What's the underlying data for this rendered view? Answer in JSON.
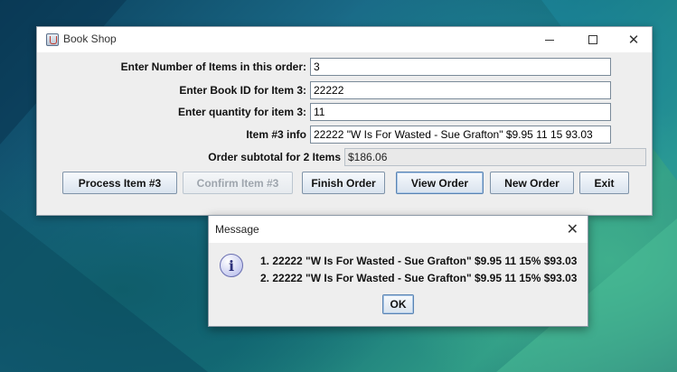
{
  "window": {
    "title": "Book Shop",
    "minimize_glyph": "",
    "maximize_glyph": "",
    "close_glyph": "✕"
  },
  "form": {
    "num_items_label": "Enter Number of Items in this order:",
    "num_items_value": "3",
    "book_id_label": "Enter Book ID for Item 3:",
    "book_id_value": "22222",
    "quantity_label": "Enter quantity for item 3:",
    "quantity_value": "11",
    "item_info_label": "Item #3 info",
    "item_info_value": "22222  \"W Is For Wasted - Sue Grafton\" $9.95 11 15 93.03",
    "subtotal_label": "Order subtotal for 2 Items",
    "subtotal_value": "$186.06"
  },
  "buttons": {
    "process": "Process Item #3",
    "confirm": "Confirm Item #3",
    "finish": "Finish Order",
    "view": "View Order",
    "new": "New Order",
    "exit": "Exit"
  },
  "dialog": {
    "title": "Message",
    "close_glyph": "✕",
    "icon_glyph": "i",
    "lines": [
      "1. 22222  \"W Is For Wasted - Sue Grafton\" $9.95 11 15% $93.03",
      "2. 22222  \"W Is For Wasted - Sue Grafton\" $9.95 11 15% $93.03"
    ],
    "ok_label": "OK"
  },
  "icons": {
    "app": "java-cup-icon",
    "info": "info-icon",
    "close": "close-icon",
    "minimize": "minimize-icon",
    "maximize": "maximize-icon"
  }
}
